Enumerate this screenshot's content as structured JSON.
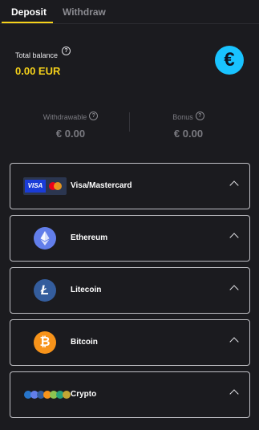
{
  "tabs": {
    "deposit": "Deposit",
    "withdraw": "Withdraw"
  },
  "balance": {
    "label": "Total balance",
    "value": "0.00 EUR",
    "currency_symbol": "€"
  },
  "withdrawable": {
    "label": "Withdrawable",
    "value": "€ 0.00"
  },
  "bonus": {
    "label": "Bonus",
    "value": "€ 0.00"
  },
  "help_glyph": "?",
  "methods": [
    {
      "name": "Visa/Mastercard",
      "icon": "visa-mastercard-icon"
    },
    {
      "name": "Ethereum",
      "icon": "ethereum-icon"
    },
    {
      "name": "Litecoin",
      "icon": "litecoin-icon"
    },
    {
      "name": "Bitcoin",
      "icon": "bitcoin-icon"
    },
    {
      "name": "Crypto",
      "icon": "crypto-coins-icon"
    }
  ],
  "colors": {
    "accent": "#f6d21a",
    "euro_badge": "#19c3ff",
    "background": "#1b1b1f"
  }
}
